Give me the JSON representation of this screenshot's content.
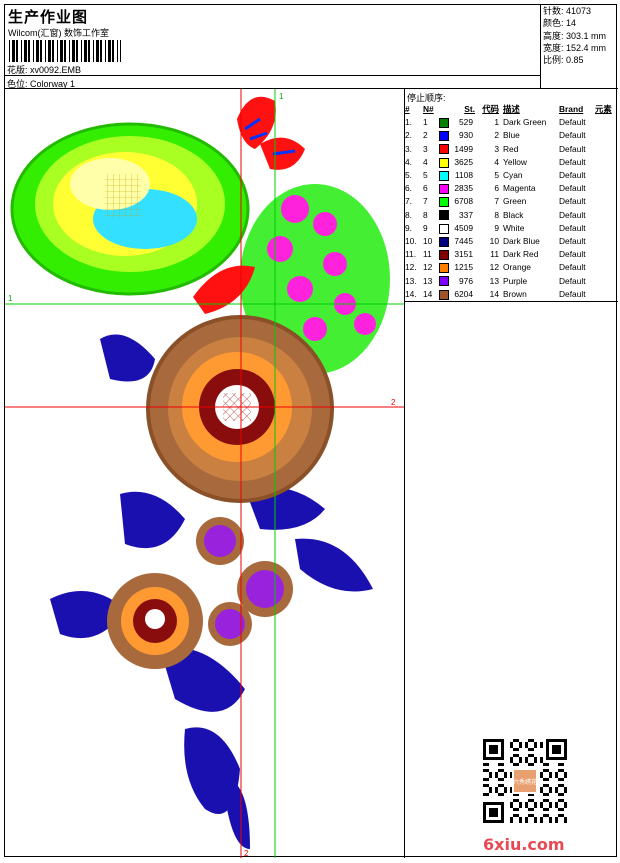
{
  "header": {
    "title": "生产作业图",
    "subtitle": "Wilcom(汇窗) 数饰工作室",
    "design_label": "花版:",
    "design_value": "xv0092.EMB",
    "colorway_label": "色位:",
    "colorway_value": "Colorway 1"
  },
  "stats": [
    {
      "label": "针数:",
      "value": "41073"
    },
    {
      "label": "颜色:",
      "value": "14"
    },
    {
      "label": "高度:",
      "value": "303.1 mm"
    },
    {
      "label": "宽度:",
      "value": "152.4 mm"
    },
    {
      "label": "比例:",
      "value": "0.85"
    }
  ],
  "guides": {
    "v1": "1",
    "h1": "1",
    "v2": "2",
    "h2": "2"
  },
  "legend": {
    "caption": "停止顺序:",
    "headers": [
      "#",
      "N#",
      "St.",
      "代码",
      "描述",
      "Brand",
      "元素"
    ],
    "rows": [
      {
        "n": "1.",
        "nn": "1",
        "color": "#008000",
        "st": "529",
        "code": "1",
        "desc": "Dark Green",
        "brand": "Default"
      },
      {
        "n": "2.",
        "nn": "2",
        "color": "#0000ff",
        "st": "930",
        "code": "2",
        "desc": "Blue",
        "brand": "Default"
      },
      {
        "n": "3.",
        "nn": "3",
        "color": "#ff0000",
        "st": "1499",
        "code": "3",
        "desc": "Red",
        "brand": "Default"
      },
      {
        "n": "4.",
        "nn": "4",
        "color": "#ffff00",
        "st": "3625",
        "code": "4",
        "desc": "Yellow",
        "brand": "Default"
      },
      {
        "n": "5.",
        "nn": "5",
        "color": "#00ffff",
        "st": "1108",
        "code": "5",
        "desc": "Cyan",
        "brand": "Default"
      },
      {
        "n": "6.",
        "nn": "6",
        "color": "#ff00ff",
        "st": "2835",
        "code": "6",
        "desc": "Magenta",
        "brand": "Default"
      },
      {
        "n": "7.",
        "nn": "7",
        "color": "#00ff00",
        "st": "6708",
        "code": "7",
        "desc": "Green",
        "brand": "Default"
      },
      {
        "n": "8.",
        "nn": "8",
        "color": "#000000",
        "st": "337",
        "code": "8",
        "desc": "Black",
        "brand": "Default"
      },
      {
        "n": "9.",
        "nn": "9",
        "color": "#ffffff",
        "st": "4509",
        "code": "9",
        "desc": "White",
        "brand": "Default"
      },
      {
        "n": "10.",
        "nn": "10",
        "color": "#000080",
        "st": "7445",
        "code": "10",
        "desc": "Dark Blue",
        "brand": "Default"
      },
      {
        "n": "11.",
        "nn": "11",
        "color": "#800000",
        "st": "3151",
        "code": "11",
        "desc": "Dark Red",
        "brand": "Default"
      },
      {
        "n": "12.",
        "nn": "12",
        "color": "#ff8000",
        "st": "1215",
        "code": "12",
        "desc": "Orange",
        "brand": "Default"
      },
      {
        "n": "13.",
        "nn": "13",
        "color": "#8000ff",
        "st": "976",
        "code": "13",
        "desc": "Purple",
        "brand": "Default"
      },
      {
        "n": "14.",
        "nn": "14",
        "color": "#a0522d",
        "st": "6204",
        "code": "14",
        "desc": "Brown",
        "brand": "Default"
      }
    ]
  },
  "watermark": "6xiu.com",
  "qr_badge": "六秀绣花"
}
